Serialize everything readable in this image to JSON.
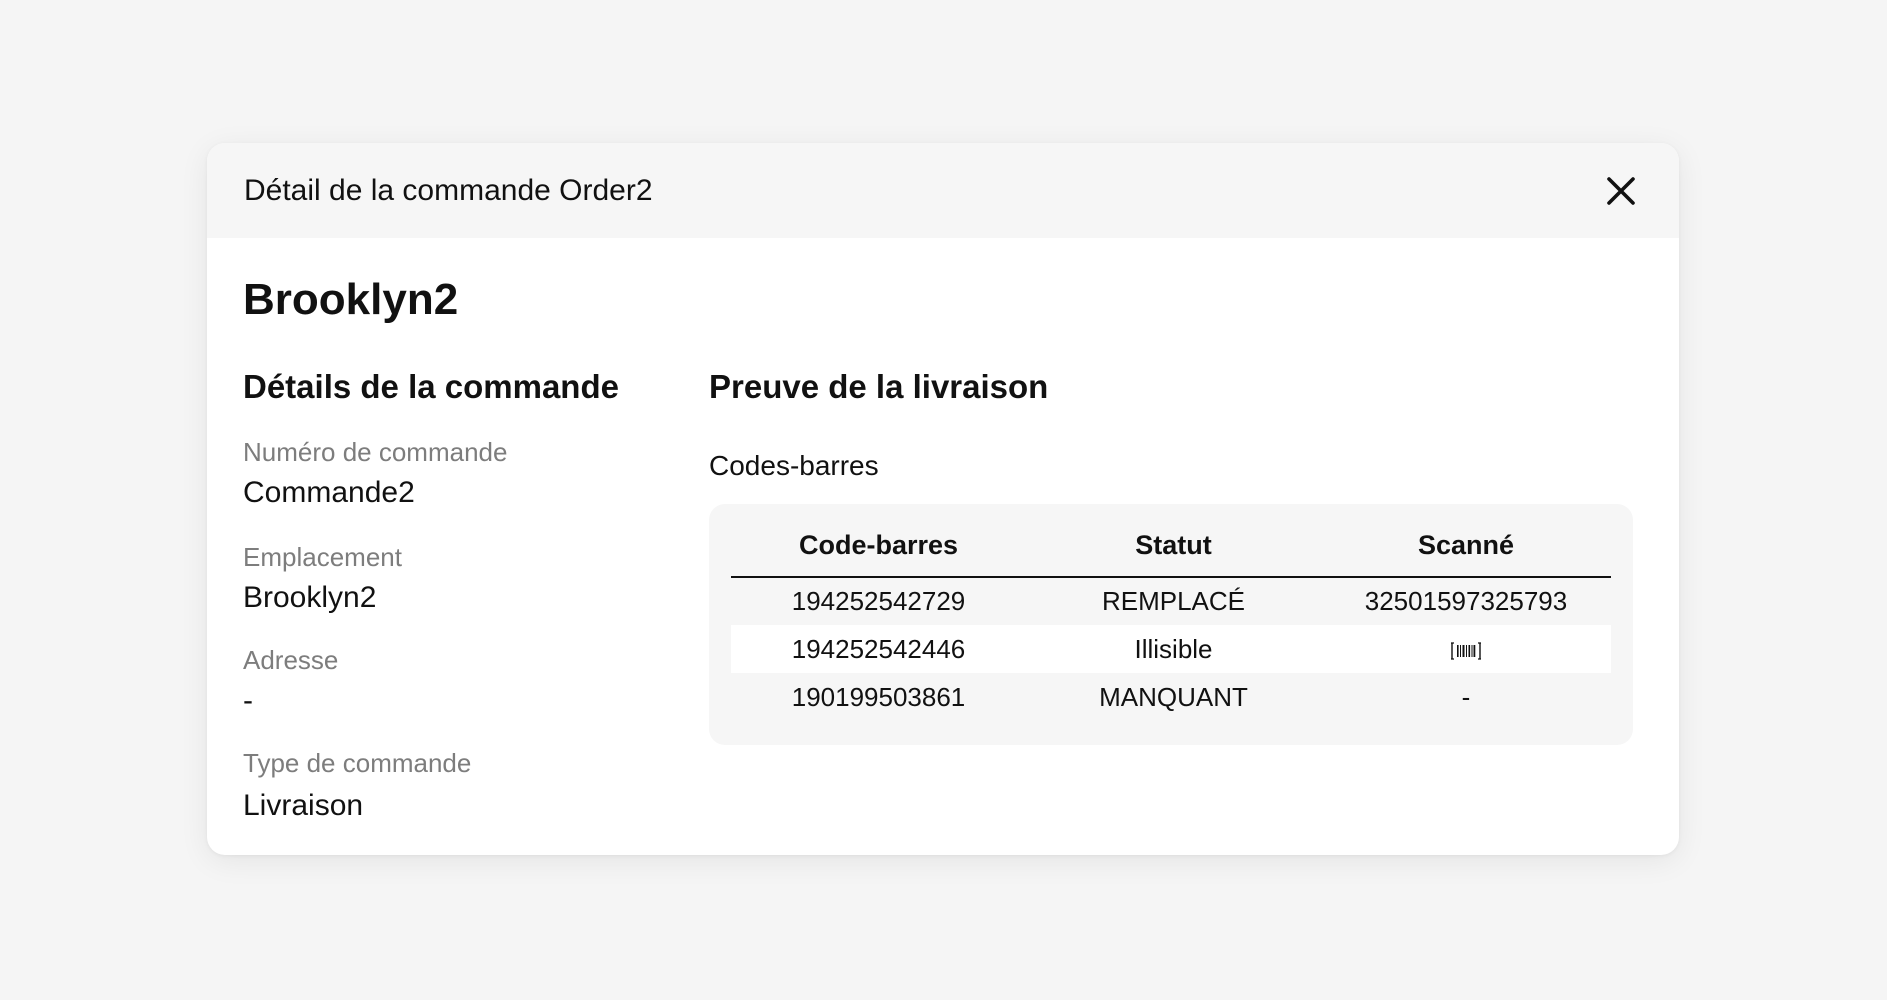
{
  "modal": {
    "title": "Détail de la commande Order2",
    "customer_name": "Brooklyn2"
  },
  "order_details": {
    "section_title": "Détails de la commande",
    "fields": [
      {
        "label": "Numéro de commande",
        "value": "Commande2"
      },
      {
        "label": "Emplacement",
        "value": "Brooklyn2"
      },
      {
        "label": "Adresse",
        "value": "-"
      },
      {
        "label": "Type de commande",
        "value": "Livraison"
      }
    ]
  },
  "proof": {
    "section_title": "Preuve de la livraison",
    "barcodes_title": "Codes-barres",
    "columns": [
      "Code-barres",
      "Statut",
      "Scanné"
    ],
    "rows": [
      {
        "barcode": "194252542729",
        "status": "REMPLACÉ",
        "scanned": "32501597325793"
      },
      {
        "barcode": "194252542446",
        "status": "Illisible",
        "scanned": "",
        "scanned_icon": "barcode-icon"
      },
      {
        "barcode": "190199503861",
        "status": "MANQUANT",
        "scanned": "-"
      }
    ]
  },
  "icons": {
    "close": "close-icon"
  }
}
